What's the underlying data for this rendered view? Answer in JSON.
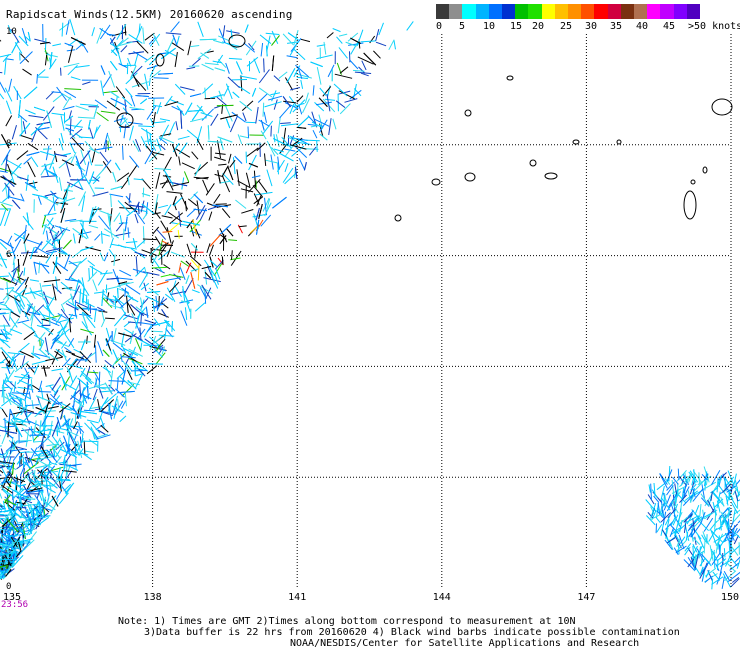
{
  "title": "Rapidscat Winds(12.5KM) 20160620 ascending",
  "legend": {
    "colors": [
      "#3a3a3a",
      "#8e8e8e",
      "#00ffff",
      "#00b4ff",
      "#0070ff",
      "#0030d0",
      "#00c000",
      "#20e000",
      "#ffff00",
      "#ffc000",
      "#ff9000",
      "#ff5000",
      "#ff0000",
      "#d00040",
      "#7a3010",
      "#b07050",
      "#ff00ff",
      "#c000ff",
      "#8000ff",
      "#5000c0"
    ],
    "labels": [
      "0",
      "5",
      "10",
      "15",
      "20",
      "25",
      "30",
      "35",
      "40",
      "45",
      ">50 knots"
    ]
  },
  "map": {
    "x_ticks": [
      "135",
      "138",
      "141",
      "144",
      "147",
      "150"
    ],
    "y_ticks": [
      "10",
      "8",
      "6",
      "4",
      "2",
      "0"
    ],
    "x_range": [
      135,
      150
    ],
    "y_range": [
      0,
      10
    ]
  },
  "timestamp": "23:56",
  "notes": {
    "line1": "Note: 1) Times are GMT 2)Times along bottom correspond to measurement at 10N",
    "line2": "3)Data buffer is 22 hrs from 20160620 4) Black wind barbs indicate possible contamination",
    "line3": "NOAA/NESDIS/Center for Satellite Applications and Research"
  }
}
